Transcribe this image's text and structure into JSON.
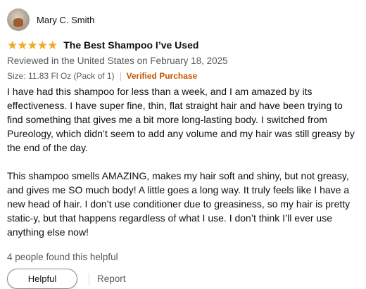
{
  "reviewer": {
    "name": "Mary C. Smith"
  },
  "rating": {
    "stars": 5,
    "max": 5,
    "color": "#f5a623"
  },
  "review": {
    "title": "The Best Shampoo I’ve Used",
    "date_line": "Reviewed in the United States on February 18, 2025",
    "format_strip": "Size: 11.83 Fl Oz (Pack of 1)",
    "verified_label": "Verified Purchase",
    "paragraphs": [
      "I have had this shampoo for less than a week, and I am amazed by its effectiveness. I have super fine, thin, flat straight hair and have been trying to find something that gives me a bit more long-lasting body. I switched from Pureology, which didn’t seem to add any volume and my hair was still greasy by the end of the day.",
      "This shampoo smells AMAZING, makes my hair soft and shiny, but not greasy, and gives me SO much body! A little goes a long way. It truly feels like I have a new head of hair. I don’t use conditioner due to greasiness, so my hair is pretty static-y, but that happens regardless of what I use. I don’t think I’ll ever use anything else now!"
    ],
    "helpful_count_text": "4 people found this helpful"
  },
  "actions": {
    "helpful_label": "Helpful",
    "report_label": "Report"
  },
  "colors": {
    "verified": "#c45500",
    "secondary_text": "#565959"
  }
}
